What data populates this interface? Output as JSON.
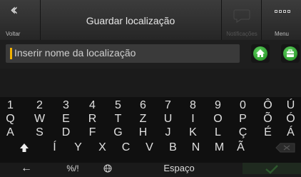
{
  "header": {
    "back_label": "Voltar",
    "title": "Guardar localização",
    "notifications_label": "Notificações",
    "menu_label": "Menu"
  },
  "input": {
    "placeholder": "Inserir nome da localização"
  },
  "keyboard": {
    "rows": [
      [
        "1",
        "2",
        "3",
        "4",
        "5",
        "6",
        "7",
        "8",
        "9",
        "0",
        "Ô",
        "Ú"
      ],
      [
        "Q",
        "W",
        "E",
        "R",
        "T",
        "Z",
        "U",
        "I",
        "O",
        "P",
        "Õ",
        "Ó"
      ],
      [
        "A",
        "S",
        "D",
        "F",
        "G",
        "H",
        "J",
        "K",
        "L",
        "Ç",
        "É",
        "Á"
      ],
      [
        "Í",
        "Y",
        "X",
        "C",
        "V",
        "B",
        "N",
        "M",
        "Ã"
      ]
    ],
    "symbols_label": "%/!",
    "space_label": "Espaço",
    "shift_icon": "up-arrow",
    "back_arrow": "←"
  },
  "colors": {
    "accent": "#f2b200",
    "green": "#3cb83c"
  }
}
